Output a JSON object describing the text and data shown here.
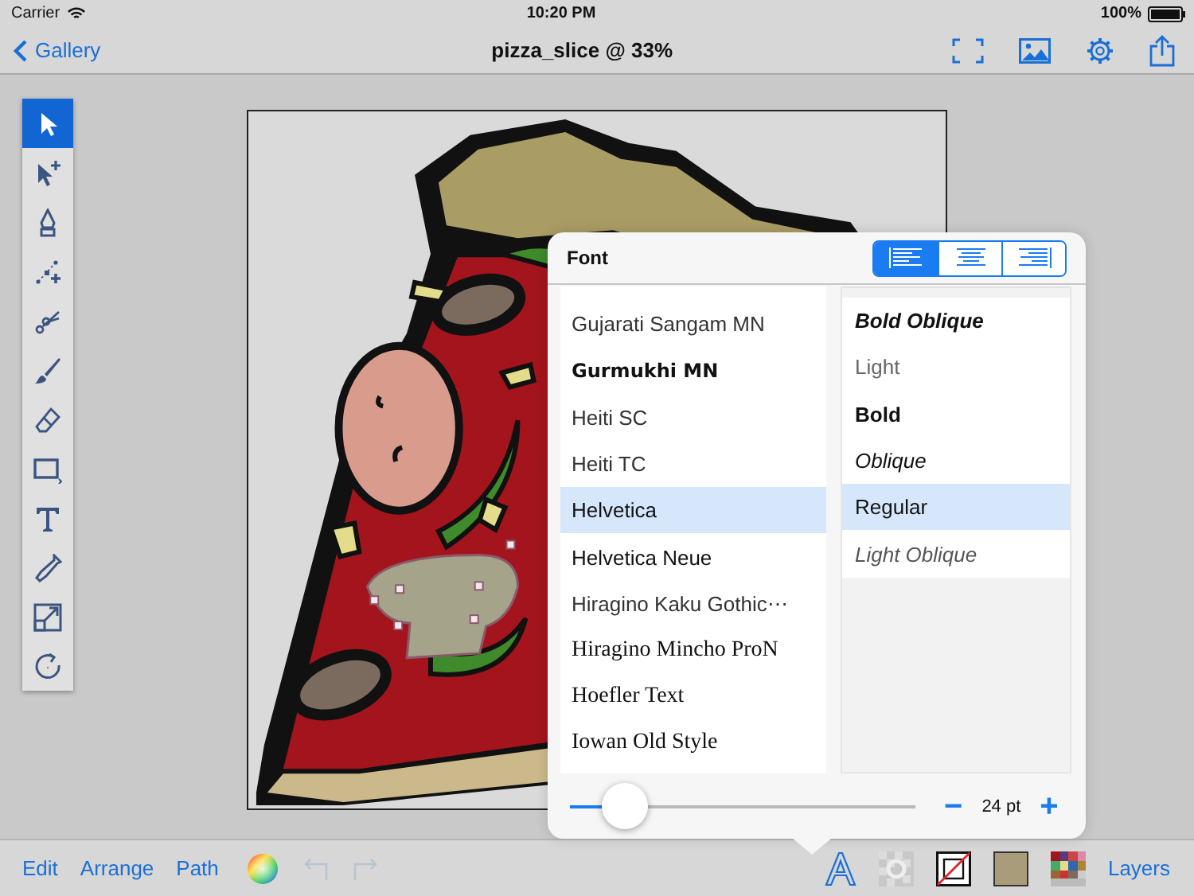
{
  "status_bar": {
    "carrier": "Carrier",
    "time": "10:20 PM",
    "battery": "100%"
  },
  "nav": {
    "back": "Gallery",
    "title": "pizza_slice @ 33%"
  },
  "tools": [
    {
      "kind": "select",
      "selected": true
    },
    {
      "kind": "direct-select",
      "selected": false
    },
    {
      "kind": "pen",
      "selected": false
    },
    {
      "kind": "add-point",
      "selected": false
    },
    {
      "kind": "scissors",
      "selected": false
    },
    {
      "kind": "brush",
      "selected": false
    },
    {
      "kind": "eraser",
      "selected": false
    },
    {
      "kind": "rectangle",
      "selected": false
    },
    {
      "kind": "text",
      "selected": false
    },
    {
      "kind": "eyedropper",
      "selected": false
    },
    {
      "kind": "scale",
      "selected": false
    },
    {
      "kind": "rotate",
      "selected": false
    }
  ],
  "font_panel": {
    "title": "Font",
    "alignments": [
      {
        "kind": "left",
        "selected": true
      },
      {
        "kind": "center",
        "selected": false
      },
      {
        "kind": "right",
        "selected": false
      }
    ],
    "fonts": [
      {
        "name": "Gujarati Sangam MN",
        "kind": "sans-light",
        "selected": false
      },
      {
        "name": "Gurmukhi MN",
        "kind": "sans-medium",
        "selected": false
      },
      {
        "name": "Heiti SC",
        "kind": "sans-light",
        "selected": false
      },
      {
        "name": "Heiti TC",
        "kind": "sans-light",
        "selected": false
      },
      {
        "name": "Helvetica",
        "kind": "sans",
        "selected": true
      },
      {
        "name": "Helvetica Neue",
        "kind": "sans",
        "selected": false
      },
      {
        "name": "Hiragino Kaku Gothic⋯",
        "kind": "sans-light",
        "selected": false
      },
      {
        "name": "Hiragino Mincho ProN",
        "kind": "serif",
        "selected": false
      },
      {
        "name": "Hoefler Text",
        "kind": "serif",
        "selected": false
      },
      {
        "name": "Iowan Old Style",
        "kind": "serif",
        "selected": false
      }
    ],
    "styles": [
      {
        "name": "Bold Oblique",
        "kind": "bold-italic",
        "selected": false
      },
      {
        "name": "Light",
        "kind": "light",
        "selected": false
      },
      {
        "name": "Bold",
        "kind": "bold",
        "selected": false
      },
      {
        "name": "Oblique",
        "kind": "italic",
        "selected": false
      },
      {
        "name": "Regular",
        "kind": "regular",
        "selected": true
      },
      {
        "name": "Light Oblique",
        "kind": "light-italic",
        "selected": false
      }
    ],
    "size": {
      "level": 0.15,
      "minus": "−",
      "value": "24 pt",
      "plus": "+"
    }
  },
  "bottom_toolbar": {
    "menus": [
      "Edit",
      "Arrange",
      "Path"
    ],
    "undo": {
      "disabled": true
    },
    "redo": {
      "disabled": true
    },
    "layers": "Layers"
  }
}
